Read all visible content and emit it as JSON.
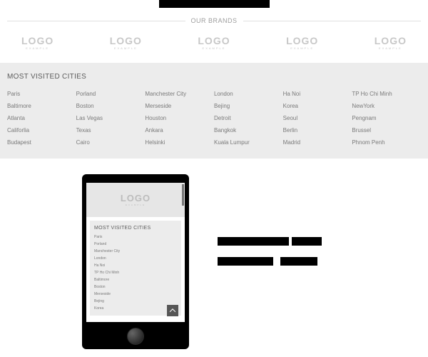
{
  "brands": {
    "label": "OUR BRANDS"
  },
  "logo": {
    "main": "LOGO",
    "sub": "EXAMPLE"
  },
  "cities": {
    "title": "MOST VISITED CITIES",
    "cols": [
      [
        "Paris",
        "Baltimore",
        "Atlanta",
        "Califorlia",
        "Budapest"
      ],
      [
        "Porland",
        "Boston",
        "Las Vegas",
        "Texas",
        "Cairo"
      ],
      [
        "Manchester City",
        "Merseside",
        "Houston",
        "Ankara",
        "Helsinki"
      ],
      [
        "London",
        "Bejing",
        "Detroit",
        "Bangkok",
        "Kuala Lumpur"
      ],
      [
        "Ha Noi",
        "Korea",
        "Seoul",
        "Berlin",
        "Madrid"
      ],
      [
        "TP Ho Chi Minh",
        "NewYork",
        "Pengnam",
        "Brussel",
        "Phnom Penh"
      ]
    ]
  },
  "phone": {
    "cities_title": "MOST VISITED CITIES",
    "cities": [
      "Paris",
      "Porland",
      "Manchester City",
      "London",
      "Ha Noi",
      "TP Ho Chi Minh",
      "Baltimore",
      "Boston",
      "Merseside",
      "Bejing",
      "Korea"
    ]
  }
}
